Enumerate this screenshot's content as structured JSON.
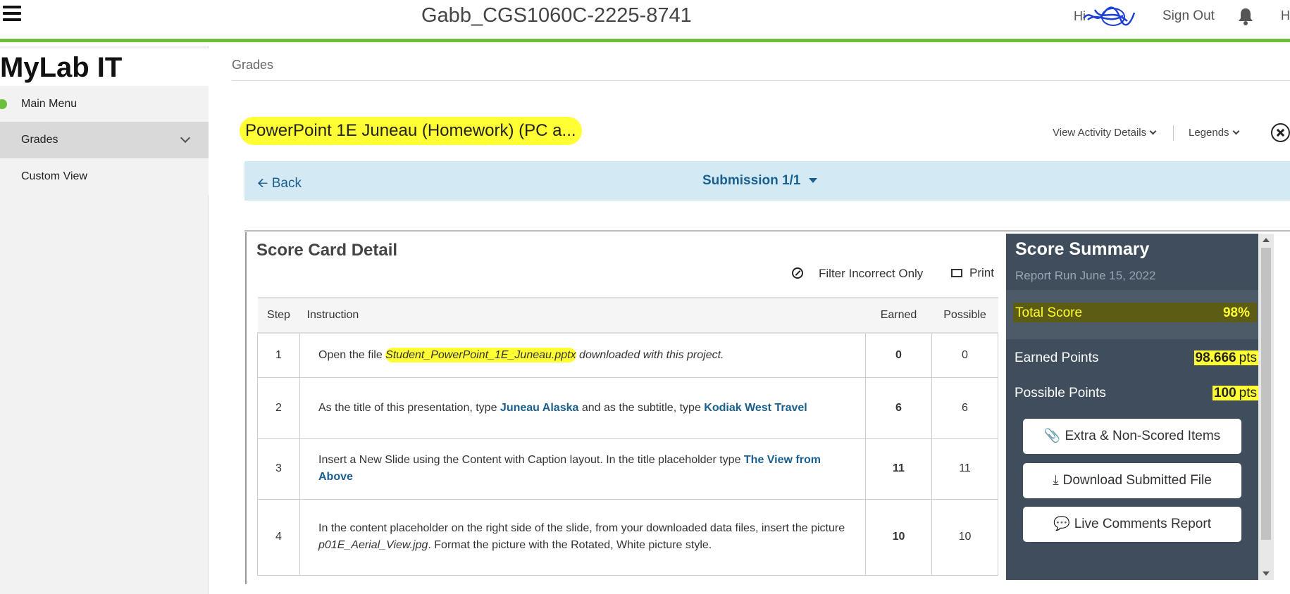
{
  "header": {
    "course_title": "Gabb_CGS1060C-2225-8741",
    "greeting": "Hi",
    "sign_out": "Sign Out",
    "cut_text": "H"
  },
  "sidebar": {
    "brand": "MyLab IT",
    "items": [
      {
        "label": "Main Menu"
      },
      {
        "label": "Grades"
      },
      {
        "label": "Custom View"
      }
    ]
  },
  "breadcrumb": "Grades",
  "assignment": {
    "title": "PowerPoint 1E Juneau (Homework) (PC a...",
    "view_details": "View Activity Details",
    "legends": "Legends"
  },
  "submission_bar": {
    "back": "Back",
    "submission": "Submission 1/1"
  },
  "score_card": {
    "title": "Score Card Detail",
    "filter": "Filter Incorrect Only",
    "print": "Print",
    "columns": [
      "Step",
      "Instruction",
      "Earned",
      "Possible"
    ],
    "rows": [
      {
        "step": "1",
        "pre": "Open the file ",
        "file": "Student_PowerPoint_1E_Juneau.pptx",
        "post": " downloaded with this project.",
        "earned": "0",
        "possible": "0"
      },
      {
        "step": "2",
        "pre": "As the title of this presentation, type ",
        "b1": "Juneau Alaska",
        "mid": " and as the subtitle, type ",
        "b2": "Kodiak West Travel",
        "earned": "6",
        "possible": "6"
      },
      {
        "step": "3",
        "pre": "Insert a New Slide using the Content with Caption layout. In the title placeholder type ",
        "b1": "The View from Above",
        "earned": "11",
        "possible": "11"
      },
      {
        "step": "4",
        "pre": "In the content placeholder on the right side of the slide, from your downloaded data files, insert the picture ",
        "file": "p01E_Aerial_View.jpg",
        "post": ". Format the picture with the Rotated, White picture style.",
        "earned": "10",
        "possible": "10"
      }
    ]
  },
  "summary": {
    "title": "Score Summary",
    "date": "Report Run June 15, 2022",
    "total_label": "Total Score",
    "total_value": "98%",
    "earned_label": "Earned Points",
    "earned_value": "98.666",
    "possible_label": "Possible Points",
    "possible_value": "100",
    "unit": "pts",
    "buttons": {
      "extra": "Extra & Non-Scored Items",
      "download": "Download Submitted File",
      "comments": "Live Comments Report"
    }
  },
  "colors": {
    "accent_green": "#6bbf3a",
    "highlight_yellow": "#ffff33",
    "link_blue": "#1a5f8e",
    "summary_bg": "#3f4d5c"
  }
}
